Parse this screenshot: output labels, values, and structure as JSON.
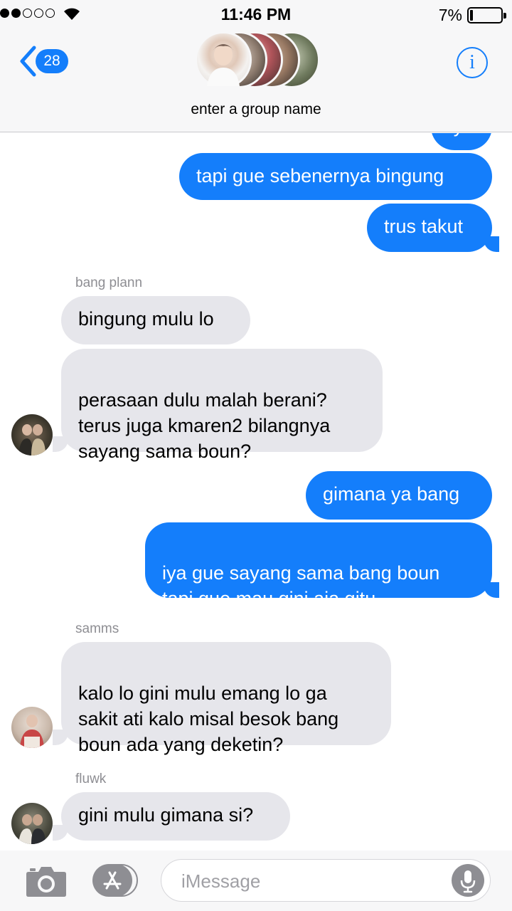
{
  "status_bar": {
    "time": "11:46 PM",
    "battery_percent": "7%",
    "signal_bars_filled": 2,
    "signal_bars_total": 5
  },
  "header": {
    "back_count": "28",
    "group_name": "enter a group name",
    "info_icon": "info-icon",
    "accent_color": "#147efb"
  },
  "messages": [
    {
      "direction": "out",
      "text": "iya"
    },
    {
      "direction": "out",
      "text": "tapi gue sebenernya bingung"
    },
    {
      "direction": "out",
      "text": "trus takut"
    },
    {
      "direction": "in",
      "sender": "bang plann",
      "text": "bingung mulu lo"
    },
    {
      "direction": "in",
      "text": "perasaan dulu malah berani?\nterus juga kmaren2 bilangnya\nsayang sama boun?"
    },
    {
      "direction": "out",
      "text": "gimana ya bang"
    },
    {
      "direction": "out",
      "text": "iya gue sayang sama bang boun\ntapi gue mau gini aja gitu"
    },
    {
      "direction": "in",
      "sender": "samms",
      "text": "kalo lo gini mulu emang lo ga\nsakit ati kalo misal besok bang\nboun ada yang deketin?"
    },
    {
      "direction": "in",
      "sender": "fluwk",
      "text": "gini mulu gimana si?"
    }
  ],
  "input": {
    "placeholder": "iMessage"
  },
  "colors": {
    "outgoing_bubble": "#147efb",
    "incoming_bubble": "#e6e6eb",
    "sender_label": "#8e8e93"
  }
}
